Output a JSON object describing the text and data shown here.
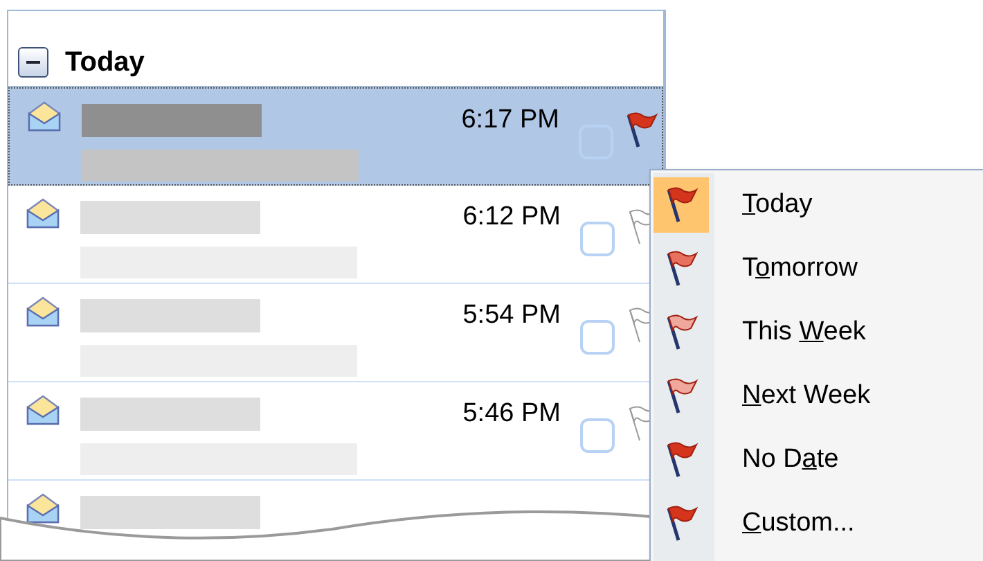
{
  "group": {
    "label": "Today",
    "expanded": true
  },
  "messages": [
    {
      "time": "6:17 PM",
      "selected": true,
      "flagged": true,
      "completed": false
    },
    {
      "time": "6:12 PM",
      "selected": false,
      "flagged": false,
      "completed": false
    },
    {
      "time": "5:54 PM",
      "selected": false,
      "flagged": false,
      "completed": false
    },
    {
      "time": "5:46 PM",
      "selected": false,
      "flagged": false,
      "completed": false
    }
  ],
  "flag_menu": [
    {
      "key": "T",
      "after": "oday",
      "color": "#d4351c",
      "selected": true
    },
    {
      "before": "T",
      "key": "o",
      "after": "morrow",
      "color": "#e8705e",
      "selected": false
    },
    {
      "before": "This ",
      "key": "W",
      "after": "eek",
      "color": "#f0a79c",
      "selected": false
    },
    {
      "key": "N",
      "after": "ext Week",
      "color": "#f0a79c",
      "selected": false
    },
    {
      "before": "No D",
      "key": "a",
      "after": "te",
      "color": "#d4351c",
      "selected": false
    },
    {
      "key": "C",
      "after": "ustom...",
      "color": "#d4351c",
      "selected": false
    }
  ]
}
